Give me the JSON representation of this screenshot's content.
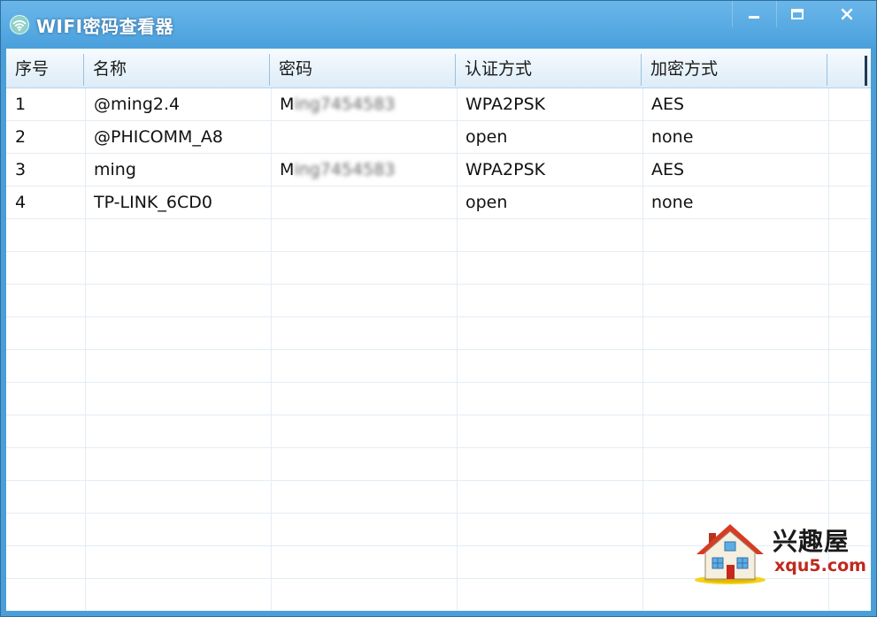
{
  "window": {
    "title": "WIFI密码查看器",
    "controls": {
      "minimize": "minimize-icon",
      "maximize": "maximize-icon",
      "close": "close-icon"
    }
  },
  "table": {
    "columns": [
      "序号",
      "名称",
      "密码",
      "认证方式",
      "加密方式"
    ],
    "rows": [
      {
        "index": "1",
        "name": "@ming2.4",
        "password_prefix": "M",
        "password_masked": "ing7454583",
        "auth": "WPA2PSK",
        "encryption": "AES"
      },
      {
        "index": "2",
        "name": "@PHICOMM_A8",
        "password_prefix": "",
        "password_masked": "",
        "auth": "open",
        "encryption": "none"
      },
      {
        "index": "3",
        "name": "ming",
        "password_prefix": "M",
        "password_masked": "ing7454583",
        "auth": "WPA2PSK",
        "encryption": "AES"
      },
      {
        "index": "4",
        "name": "TP-LINK_6CD0",
        "password_prefix": "",
        "password_masked": "",
        "auth": "open",
        "encryption": "none"
      }
    ]
  },
  "watermark": {
    "brand": "兴趣屋",
    "url": "xqu5.com",
    "icon": "house-logo-icon"
  },
  "colors": {
    "titlebar": "#4aa0dc",
    "header": "#dcecf8",
    "gridline": "#e3edf5",
    "url": "#c0281e"
  }
}
